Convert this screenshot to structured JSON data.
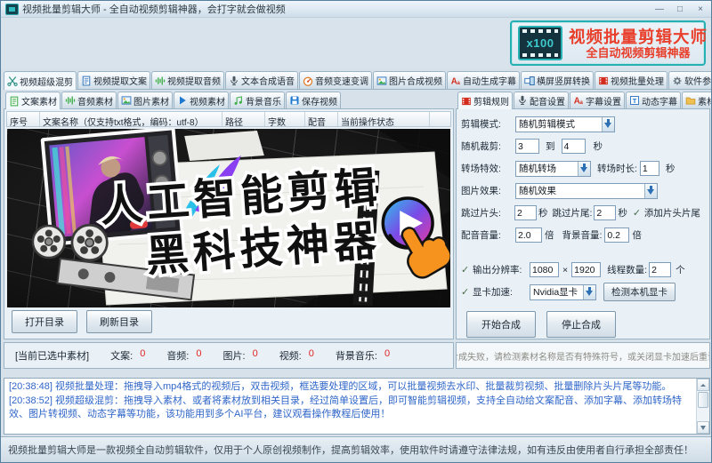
{
  "window": {
    "title": "视频批量剪辑大师 - 全自动视频剪辑神器，会打字就会做视频",
    "minimize": "—",
    "maximize": "□",
    "close": "×"
  },
  "brand": {
    "badge": "x100",
    "title": "视频批量剪辑大师",
    "subtitle": "全自动视频剪辑神器",
    "accent_color": "#e8402c",
    "border_color": "#25b0b4"
  },
  "main_tabs": [
    {
      "label": "视频超级混剪",
      "icon": "scissors-icon",
      "active": true
    },
    {
      "label": "视频提取文案",
      "icon": "document-icon",
      "active": false
    },
    {
      "label": "视频提取音频",
      "icon": "waveform-icon",
      "active": false
    },
    {
      "label": "文本合成语音",
      "icon": "microphone-icon",
      "active": false
    },
    {
      "label": "音频变速变调",
      "icon": "gauge-icon",
      "active": false
    },
    {
      "label": "图片合成视频",
      "icon": "image-icon",
      "active": false
    },
    {
      "label": "自动生成字幕",
      "icon": "subtitle-a-icon",
      "active": false
    },
    {
      "label": "横屏竖屏转换",
      "icon": "rotate-screen-icon",
      "active": false
    },
    {
      "label": "视频批量处理",
      "icon": "filmstrip-icon",
      "active": false
    },
    {
      "label": "软件参数设置",
      "icon": "gear-icon",
      "active": false
    }
  ],
  "material_tabs": [
    {
      "label": "文案素材",
      "icon": "text-doc-icon",
      "active": true
    },
    {
      "label": "音频素材",
      "icon": "waveform-icon",
      "active": false
    },
    {
      "label": "图片素材",
      "icon": "image-icon",
      "active": false
    },
    {
      "label": "视频素材",
      "icon": "play-icon",
      "active": false
    },
    {
      "label": "背景音乐",
      "icon": "music-note-icon",
      "active": false
    },
    {
      "label": "保存视频",
      "icon": "save-icon",
      "active": false
    }
  ],
  "table": {
    "headers": [
      "序号",
      "文案名称（仅支持txt格式，编码：utf-8）",
      "路径",
      "字数",
      "配音",
      "当前操作状态"
    ]
  },
  "banner": {
    "line1": "人工智能剪辑",
    "line2": "黑科技神器"
  },
  "dir_buttons": {
    "open": "打开目录",
    "refresh": "刷新目录"
  },
  "selection": {
    "prefix": "[当前已选中素材]",
    "items": [
      {
        "label": "文案:",
        "value": "0"
      },
      {
        "label": "音频:",
        "value": "0"
      },
      {
        "label": "图片:",
        "value": "0"
      },
      {
        "label": "视频:",
        "value": "0"
      },
      {
        "label": "背景音乐:",
        "value": "0"
      }
    ]
  },
  "rule_tabs": [
    {
      "label": "剪辑规则",
      "icon": "filmstrip-icon",
      "active": true
    },
    {
      "label": "配音设置",
      "icon": "microphone-icon",
      "active": false
    },
    {
      "label": "字幕设置",
      "icon": "subtitle-a-icon",
      "active": false
    },
    {
      "label": "动态字幕",
      "icon": "dynamic-text-icon",
      "active": false
    },
    {
      "label": "素材目录",
      "icon": "folder-icon",
      "active": false
    }
  ],
  "rules": {
    "check": "✓",
    "clip_mode_label": "剪辑模式:",
    "clip_mode_value": "随机剪辑模式",
    "random_cut_label": "随机裁剪:",
    "cut_from": "3",
    "to_label": "到",
    "cut_to": "4",
    "unit_sec": "秒",
    "transition_label": "转场特效:",
    "transition_value": "随机转场",
    "transition_dur_label": "转场时长:",
    "transition_dur": "1",
    "image_fx_label": "图片效果:",
    "image_fx_value": "随机效果",
    "skip_intro_label": "跳过片头:",
    "skip_intro": "2",
    "skip_outro_label": "跳过片尾:",
    "skip_outro": "2",
    "add_intro_outro_label": "添加片头片尾",
    "voice_vol_label": "配音音量:",
    "voice_vol": "2.0",
    "unit_times": "倍",
    "bgm_vol_label": "背景音量:",
    "bgm_vol": "0.2",
    "resolution_label": "输出分辨率:",
    "res_w": "1080",
    "res_sep": "×",
    "res_h": "1920",
    "threads_label": "线程数量:",
    "threads": "2",
    "unit_count": "个",
    "gpu_label": "显卡加速:",
    "gpu_value": "Nvidia显卡",
    "detect_gpu_label": "检测本机显卡",
    "start_label": "开始合成",
    "stop_label": "停止合成"
  },
  "alert": {
    "text": "合成失败，请检测素材名称是否有特殊符号，或关闭显卡加速后重试"
  },
  "log": {
    "lines": [
      "[20:38:48] 视频批量处理：拖拽导入mp4格式的视频后，双击视频，框选要处理的区域，可以批量视频去水印、批量裁剪视频、批量删除片头片尾等功能。",
      "[20:38:52] 视频超级混剪：拖拽导入素材、或者将素材放到相关目录，经过简单设置后，即可智能剪辑视频，支持全自动给文案配音、添加字幕、添加转场特效、图片转视频、动态字幕等功能，该功能用到多个AI平台，建议观看操作教程后使用！"
    ]
  },
  "footer": {
    "text": "视频批量剪辑大师是一款视频全自动剪辑软件，仅用于个人原创视频制作，提高剪辑效率，使用软件时请遵守法律法规，如有违反由使用者自行承担全部责任！"
  }
}
